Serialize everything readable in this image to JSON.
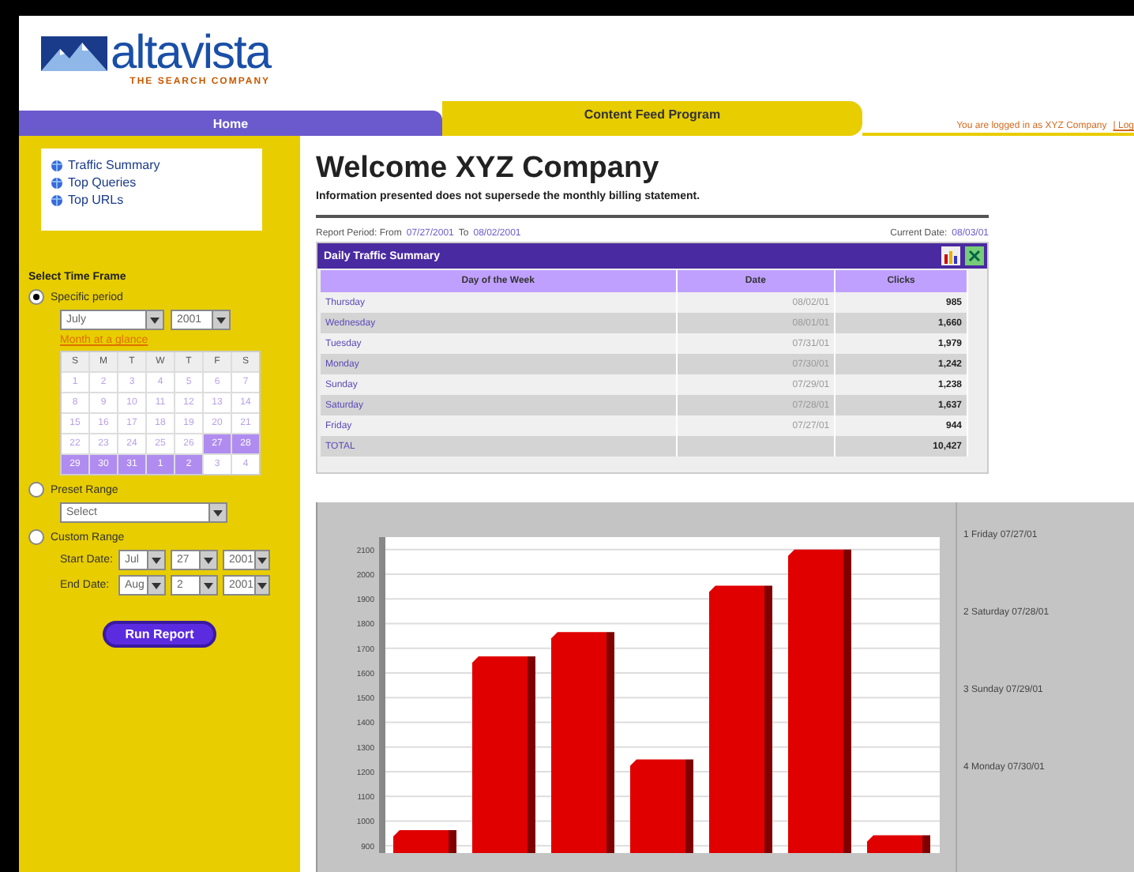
{
  "logo": {
    "name": "altavista",
    "tagline": "THE SEARCH COMPANY"
  },
  "tabs": [
    {
      "label": "Home",
      "selected": false
    },
    {
      "label": "Content Feed Program",
      "selected": true
    }
  ],
  "login": {
    "text": "You are logged in as XYZ Company",
    "link": "| Log"
  },
  "sidebar": {
    "links": [
      "Traffic Summary",
      "Top Queries",
      "Top URLs"
    ],
    "time_frame_title": "Select Time Frame",
    "specific": {
      "label": "Specific period",
      "selected": true,
      "month": "July",
      "year": "2001",
      "calendar_link": "Month at a glance",
      "weekdays": [
        "S",
        "M",
        "T",
        "W",
        "T",
        "F",
        "S"
      ],
      "days": [
        {
          "day": "1",
          "selected": false
        },
        {
          "day": "2",
          "selected": false
        },
        {
          "day": "3",
          "selected": false
        },
        {
          "day": "4",
          "selected": false
        },
        {
          "day": "5",
          "selected": false
        },
        {
          "day": "6",
          "selected": false
        },
        {
          "day": "7",
          "selected": false
        },
        {
          "day": "8",
          "selected": false
        },
        {
          "day": "9",
          "selected": false
        },
        {
          "day": "10",
          "selected": false
        },
        {
          "day": "11",
          "selected": false
        },
        {
          "day": "12",
          "selected": false
        },
        {
          "day": "13",
          "selected": false
        },
        {
          "day": "14",
          "selected": false
        },
        {
          "day": "15",
          "selected": false
        },
        {
          "day": "16",
          "selected": false
        },
        {
          "day": "17",
          "selected": false
        },
        {
          "day": "18",
          "selected": false
        },
        {
          "day": "19",
          "selected": false
        },
        {
          "day": "20",
          "selected": false
        },
        {
          "day": "21",
          "selected": false
        },
        {
          "day": "22",
          "selected": false
        },
        {
          "day": "23",
          "selected": false
        },
        {
          "day": "24",
          "selected": false
        },
        {
          "day": "25",
          "selected": false
        },
        {
          "day": "26",
          "selected": false
        },
        {
          "day": "27",
          "selected": true
        },
        {
          "day": "28",
          "selected": true
        },
        {
          "day": "29",
          "selected": true
        },
        {
          "day": "30",
          "selected": true
        },
        {
          "day": "31",
          "selected": true
        },
        {
          "day": "1",
          "selected": true
        },
        {
          "day": "2",
          "selected": true
        },
        {
          "day": "3",
          "selected": false
        },
        {
          "day": "4",
          "selected": false
        }
      ]
    },
    "preset": {
      "label": "Preset Range",
      "selected": false,
      "value": "Select"
    },
    "custom": {
      "label": "Custom Range",
      "selected": false,
      "start_label": "Start Date:",
      "start": [
        "Jul",
        "27",
        "2001"
      ],
      "end_label": "End Date:",
      "end": [
        "Aug",
        "2",
        "2001"
      ]
    },
    "run_button": "Run Report"
  },
  "content": {
    "title": "Welcome XYZ Company",
    "subtitle": "Information presented does not supersede the monthly billing statement.",
    "period_label": "Report Period: From",
    "period_from": "07/27/2001",
    "period_to_label": "To",
    "period_to": "08/02/2001",
    "current_label": "Current Date:",
    "current_date": "08/03/01",
    "panel_title": "Daily Traffic Summary",
    "table": {
      "columns": [
        "Day of the Week",
        "Date",
        "Clicks"
      ],
      "rows": [
        [
          "Thursday",
          "08/02/01",
          "985"
        ],
        [
          "Wednesday",
          "08/01/01",
          "1,660"
        ],
        [
          "Tuesday",
          "07/31/01",
          "1,979"
        ],
        [
          "Monday",
          "07/30/01",
          "1,242"
        ],
        [
          "Sunday",
          "07/29/01",
          "1,238"
        ],
        [
          "Saturday",
          "07/28/01",
          "1,637"
        ],
        [
          "Friday",
          "07/27/01",
          "944"
        ],
        [
          "TOTAL",
          "",
          "10,427"
        ]
      ]
    },
    "chart_data": {
      "type": "bar",
      "grid": true,
      "series": [
        {
          "color": "#e00000",
          "values": [
            963,
            1667,
            1765,
            1249,
            1953,
            2100,
            942
          ]
        }
      ],
      "ylim": [
        870,
        2150
      ],
      "yticks": [
        900,
        1000,
        1100,
        1200,
        1300,
        1400,
        1500,
        1600,
        1700,
        1800,
        1900,
        2000,
        2100
      ]
    },
    "legend": [
      "1 Friday 07/27/01",
      "2 Saturday 07/28/01",
      "3 Sunday 07/29/01",
      "4 Monday 07/30/01"
    ]
  }
}
